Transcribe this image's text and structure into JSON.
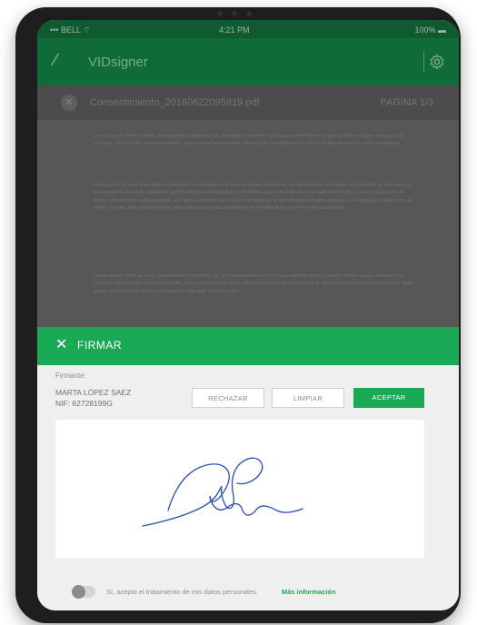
{
  "status_bar": {
    "carrier": "••• BELL ⌔",
    "time": "4:21 PM",
    "battery": "100% ▬"
  },
  "header": {
    "logo": "⁄⁄⁄",
    "app_name": "VIDsigner",
    "settings_icon": "gear-icon"
  },
  "document": {
    "close_symbol": "✕",
    "file_name": "Consentimiento_20160622095919.pdf",
    "page_label": "PAGINA 1/3"
  },
  "doc_paragraphs": [
    "Lorem ipsum dolor sit amet, consectetuer adipiscing elit, sed diam nonummy nibh euis-mod tincidunt ut laoreet dolore magna aliquam erat volutpat. Ut wisi enim ad minim veniam, quis nostrud exerci tation ullamcorper suscipit lobortis nisl ut aliquip ex ea com-modo consequat.",
    "Duis autem vel eum iriure dolor in hendrerit in vulputate velit esse molestie consequat, vel illum dolore eu feugiat nulla facilisis at vero eros et accumsan et iusto odio dignissim qui blandit praesent luptatum zzril delenit augue duis dolore te feugait nulla facilisi. Lorem ipsum dolor sit amet, cons ectetuer adipiscing elit, sed diam nonummy nibh euis-mod tincidunt ut laoreet dolore magna aliquam erat volutpat. Ut wisi enim ad minim veniam, quis nostrud exerci tation ullamcorper suscipit lobortis nisl ut aliquip ex ea com-modo consequat.",
    "Lorem ipsum dolor sit amet, consectetuer adipiscing elit, sed diam nonummy nibh euis-mod tincidunt ut laoreet dolore magna aliquam erat volutpat. Ut wisi enim ad minim veniam, quis nostrud exerci tation ullamcorper suscipit lobortis nisl ut aliquip ex ea com-modo consequat. Duis autem vel eum iriure dolor in hendrerit in vulputate velit esse mo-"
  ],
  "firmar": {
    "close_symbol": "✕",
    "title": "FIRMAR"
  },
  "signer": {
    "label": "Firmante:",
    "name": "MARTA LÓPEZ SAEZ",
    "nif": "NIF: 62728199G"
  },
  "buttons": {
    "reject": "RECHAZAR",
    "clear": "LIMPIAR",
    "accept": "ACEPTAR"
  },
  "consent": {
    "text": "Sí, acepto el tratamiento de mis datos personales.",
    "link": "Más información",
    "checked": false
  },
  "colors": {
    "accent": "#1aaa55",
    "header_dark": "#0f6b37",
    "signature_ink": "#2b4fb0"
  }
}
